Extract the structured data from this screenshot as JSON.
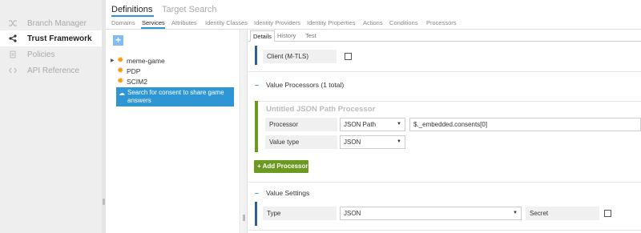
{
  "left_nav": {
    "items": [
      {
        "label": "Branch Manager",
        "icon": "shuffle-icon",
        "active": false
      },
      {
        "label": "Trust Framework",
        "icon": "share-nodes-icon",
        "active": true
      },
      {
        "label": "Policies",
        "icon": "document-icon",
        "active": false
      },
      {
        "label": "API Reference",
        "icon": "code-icon",
        "active": false
      }
    ]
  },
  "header": {
    "tabs": [
      "Definitions",
      "Target Search"
    ],
    "active_tab": "Definitions",
    "subtabs": [
      "Domains",
      "Services",
      "Attributes",
      "Identity Classes",
      "Identity Providers",
      "Identity Properties",
      "Actions",
      "Conditions",
      "Processors"
    ],
    "active_subtab": "Services"
  },
  "tree": {
    "add_label": "+",
    "items": [
      "meme-game",
      "PDP",
      "SCIM2"
    ],
    "selected": "Search for consent to share game answers"
  },
  "details": {
    "tabs": [
      "Details",
      "History",
      "Test"
    ],
    "active_tab": "Details",
    "client_mtls_label": "Client (M-TLS)",
    "value_processors_title": "Value Processors (1 total)",
    "processor": {
      "title": "Untitled JSON Path Processor",
      "processor_label": "Processor",
      "processor_value": "JSON Path",
      "expression": "$._embedded.consents[0]",
      "value_type_label": "Value type",
      "value_type": "JSON"
    },
    "add_processor_label": "+ Add Processor",
    "value_settings_title": "Value Settings",
    "type_label": "Type",
    "type_value": "JSON",
    "secret_label": "Secret"
  },
  "colors": {
    "accent": "#2f96d6",
    "green": "#6a9a1f",
    "gear": "#f39c12"
  }
}
